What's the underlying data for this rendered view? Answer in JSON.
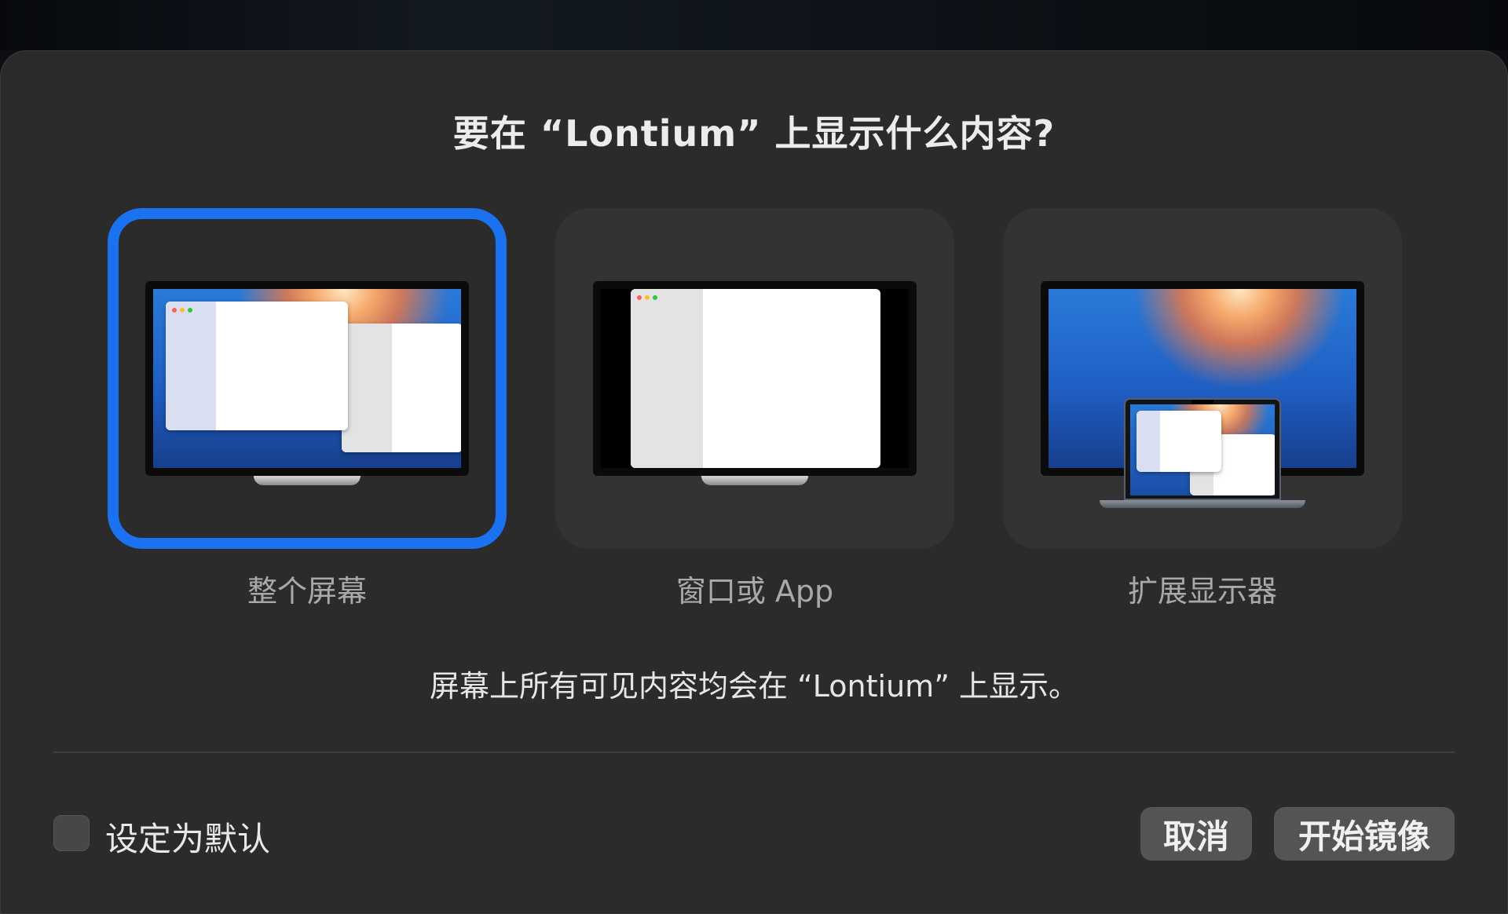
{
  "dialog": {
    "title": "要在 “Lontium” 上显示什么内容?",
    "description": "屏幕上所有可见内容均会在 “Lontium” 上显示。"
  },
  "options": [
    {
      "id": "entire",
      "label": "整个屏幕",
      "selected": true,
      "icon": "entire-screen-illustration"
    },
    {
      "id": "window",
      "label": "窗口或 App",
      "selected": false,
      "icon": "window-or-app-illustration"
    },
    {
      "id": "extend",
      "label": "扩展显示器",
      "selected": false,
      "icon": "extended-display-illustration"
    }
  ],
  "footer": {
    "checkbox_label": "设定为默认",
    "checkbox_checked": false,
    "cancel_label": "取消",
    "start_label": "开始镜像"
  },
  "colors": {
    "selection_accent": "#1a72f0",
    "dialog_background": "#2b2b2b"
  }
}
